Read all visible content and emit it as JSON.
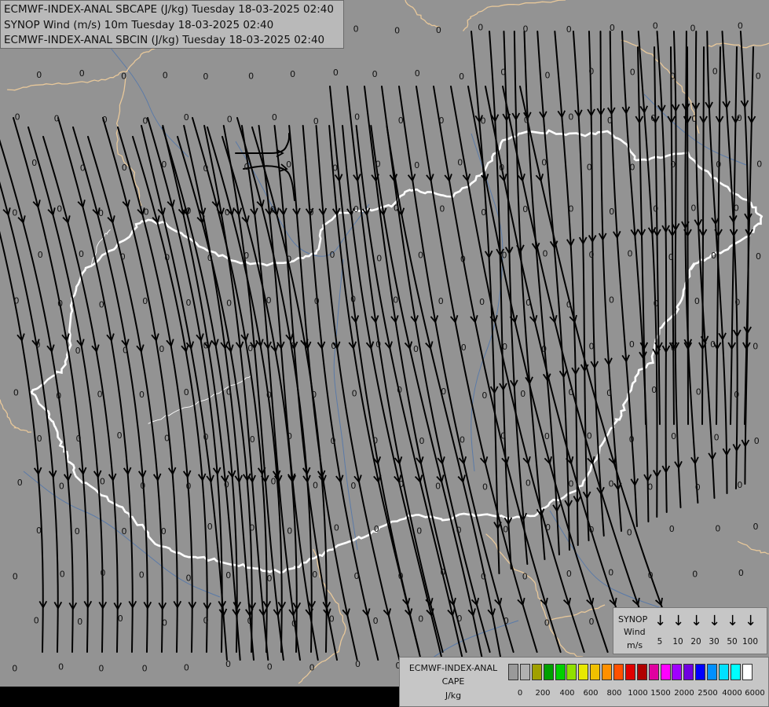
{
  "title": {
    "line1": "ECMWF-INDEX-ANAL SBCAPE (J/kg) Tuesday 18-03-2025 02:40",
    "line2": "SYNOP Wind (m/s) 10m Tuesday 18-03-2025 02:40",
    "line3": "ECMWF-INDEX-ANAL SBCIN (J/kg) Tuesday 18-03-2025 02:40"
  },
  "map": {
    "background_color": "#939393",
    "streamline_color": "#000000",
    "border_color": "#ffffff",
    "coast_color": "#e8c89a",
    "river_color": "#5a7aa8",
    "value_label": "0",
    "faded_value_label": "0.669"
  },
  "wind_legend": {
    "title": "SYNOP",
    "subtitle": "Wind",
    "unit": "m/s",
    "speeds": [
      "5",
      "10",
      "20",
      "30",
      "50",
      "100"
    ]
  },
  "cape_legend": {
    "title_line1": "ECMWF-INDEX-ANAL",
    "title_line2": "CAPE",
    "unit": "J/kg",
    "colors": [
      "#9a9a9a",
      "#b0b0b0",
      "#a0a000",
      "#00a000",
      "#00d000",
      "#90e000",
      "#e8e800",
      "#f0c000",
      "#ff9000",
      "#ff5000",
      "#e00000",
      "#b00000",
      "#e000a0",
      "#ff00ff",
      "#a000ff",
      "#7000e0",
      "#0000ff",
      "#0090ff",
      "#00e0ff",
      "#00ffff",
      "#ffffff"
    ],
    "ticks": [
      "0",
      "200",
      "400",
      "600",
      "800",
      "1000",
      "1500",
      "2000",
      "2500",
      "4000",
      "6000"
    ]
  }
}
